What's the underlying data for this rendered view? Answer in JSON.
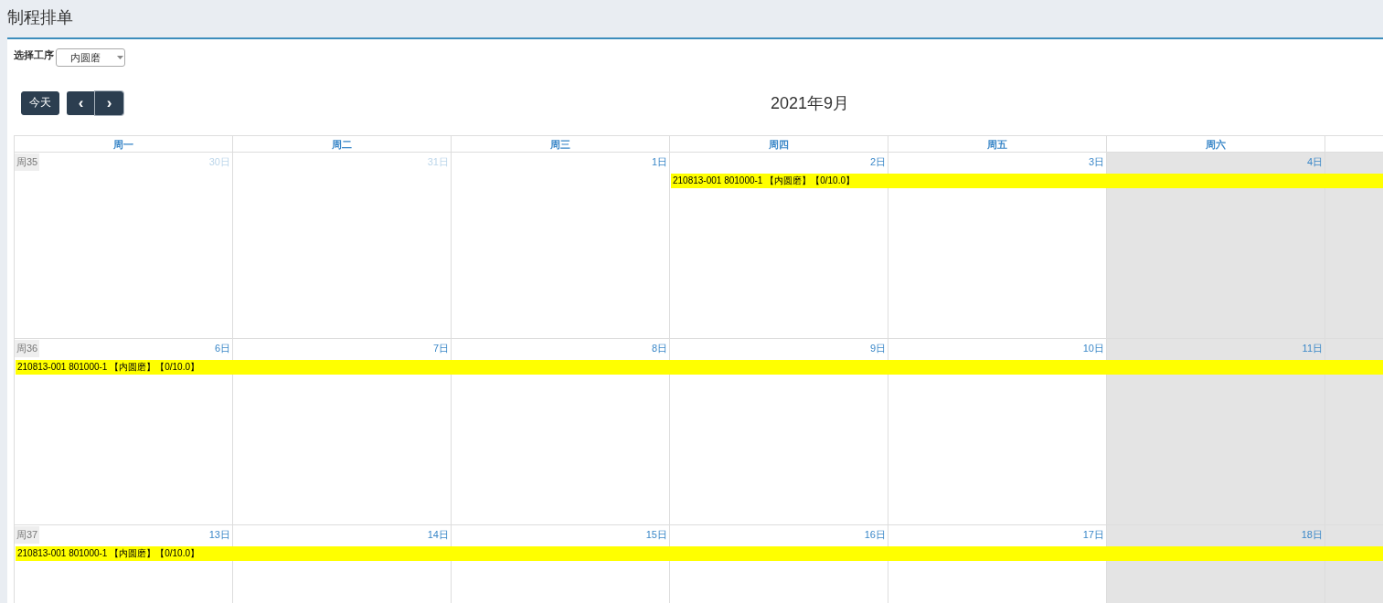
{
  "page_title": "制程排单",
  "filter": {
    "label": "选择工序",
    "value": "内圆磨"
  },
  "toolbar": {
    "today": "今天",
    "prev": "‹",
    "next": "›",
    "title": "2021年9月"
  },
  "weekdays": [
    "周一",
    "周二",
    "周三",
    "周四",
    "周五",
    "周六"
  ],
  "weeks": [
    {
      "week_label": "周35",
      "days": [
        {
          "date": "30日",
          "other_month": true,
          "weekend": false
        },
        {
          "date": "31日",
          "other_month": true,
          "weekend": false
        },
        {
          "date": "1日",
          "other_month": false,
          "weekend": false
        },
        {
          "date": "2日",
          "other_month": false,
          "weekend": false,
          "event": "210813-001 801000-1 【内圆磨】【0/10.0】"
        },
        {
          "date": "3日",
          "other_month": false,
          "weekend": false
        },
        {
          "date": "4日",
          "other_month": false,
          "weekend": true
        },
        {
          "weekend": true
        }
      ]
    },
    {
      "week_label": "周36",
      "days": [
        {
          "date": "6日",
          "other_month": false,
          "weekend": false,
          "event": "210813-001 801000-1 【内圆磨】【0/10.0】"
        },
        {
          "date": "7日",
          "other_month": false,
          "weekend": false
        },
        {
          "date": "8日",
          "other_month": false,
          "weekend": false
        },
        {
          "date": "9日",
          "other_month": false,
          "weekend": false
        },
        {
          "date": "10日",
          "other_month": false,
          "weekend": false
        },
        {
          "date": "11日",
          "other_month": false,
          "weekend": true
        },
        {
          "weekend": true
        }
      ]
    },
    {
      "week_label": "周37",
      "days": [
        {
          "date": "13日",
          "other_month": false,
          "weekend": false,
          "event": "210813-001 801000-1 【内圆磨】【0/10.0】"
        },
        {
          "date": "14日",
          "other_month": false,
          "weekend": false
        },
        {
          "date": "15日",
          "other_month": false,
          "weekend": false
        },
        {
          "date": "16日",
          "other_month": false,
          "weekend": false
        },
        {
          "date": "17日",
          "other_month": false,
          "weekend": false
        },
        {
          "date": "18日",
          "other_month": false,
          "weekend": true
        },
        {
          "weekend": true
        }
      ]
    }
  ]
}
